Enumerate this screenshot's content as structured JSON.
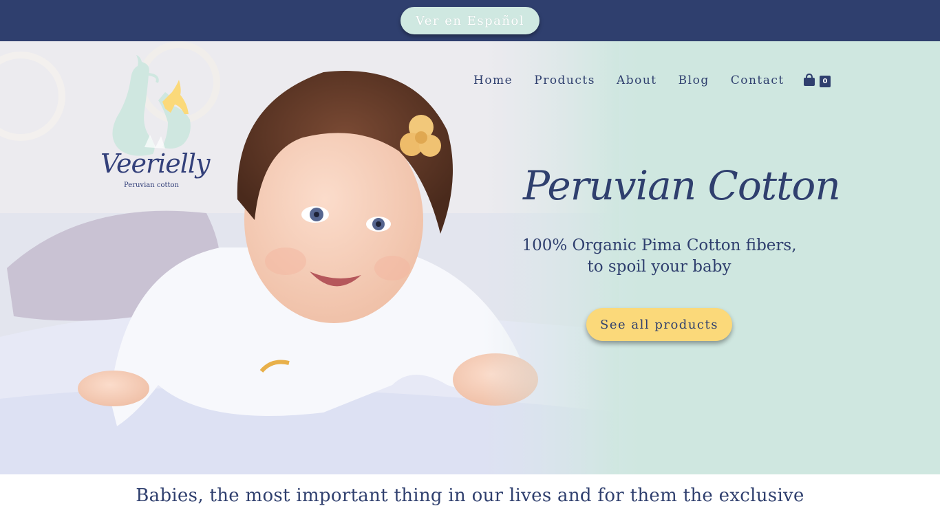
{
  "topbar": {
    "language_button": "Ver en Español"
  },
  "logo": {
    "wordmark": "Veerielly",
    "subtitle": "Peruvian cotton"
  },
  "nav": {
    "items": [
      {
        "label": "Home"
      },
      {
        "label": "Products"
      },
      {
        "label": "About"
      },
      {
        "label": "Blog"
      },
      {
        "label": "Contact"
      }
    ],
    "cart_icon": "shopping-bag-icon",
    "cart_count": "0"
  },
  "hero": {
    "title": "Peruvian Cotton",
    "subtitle_line1": "100% Organic Pima Cotton fibers,",
    "subtitle_line2": "to spoil your baby",
    "cta_label": "See all products"
  },
  "tagline": "Babies, the most important thing in our lives and for them the exclusive",
  "colors": {
    "navy": "#2f3f6e",
    "mint": "#cfe7e0",
    "yellow": "#fbd97a",
    "white": "#ffffff"
  }
}
